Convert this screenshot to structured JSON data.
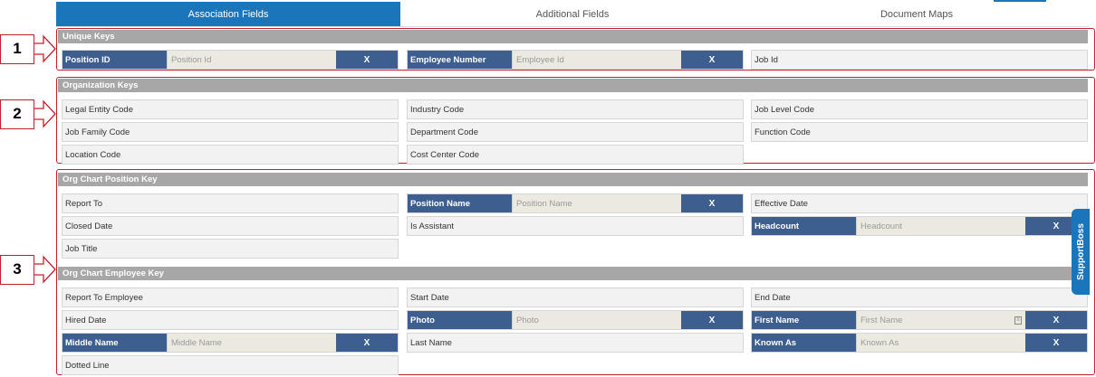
{
  "tabs": [
    {
      "label": "Association Fields"
    },
    {
      "label": "Additional Fields"
    },
    {
      "label": "Document Maps"
    }
  ],
  "callouts": [
    "1",
    "2",
    "3"
  ],
  "sections": {
    "unique_keys": "Unique Keys",
    "organization_keys": "Organization Keys",
    "org_chart_position_key": "Org Chart Position Key",
    "org_chart_employee_key": "Org Chart Employee Key"
  },
  "remove_label": "X",
  "fields": {
    "position_id": {
      "label": "Position ID",
      "placeholder": "Position Id"
    },
    "employee_number": {
      "label": "Employee Number",
      "placeholder": "Employee Id"
    },
    "job_id": "Job Id",
    "legal_entity_code": "Legal Entity Code",
    "industry_code": "Industry Code",
    "job_level_code": "Job Level Code",
    "job_family_code": "Job Family Code",
    "department_code": "Department Code",
    "function_code": "Function Code",
    "location_code": "Location Code",
    "cost_center_code": "Cost Center Code",
    "report_to": "Report To",
    "position_name": {
      "label": "Position Name",
      "placeholder": "Position Name"
    },
    "effective_date": "Effective Date",
    "closed_date": "Closed Date",
    "is_assistant": "Is Assistant",
    "headcount": {
      "label": "Headcount",
      "placeholder": "Headcount"
    },
    "job_title": "Job Title",
    "report_to_employee": "Report To Employee",
    "start_date": "Start Date",
    "end_date": "End Date",
    "hired_date": "Hired Date",
    "photo": {
      "label": "Photo",
      "placeholder": "Photo"
    },
    "first_name": {
      "label": "First Name",
      "placeholder": "First Name"
    },
    "middle_name": {
      "label": "Middle Name",
      "placeholder": "Middle Name"
    },
    "last_name": "Last Name",
    "known_as": {
      "label": "Known As",
      "placeholder": "Known As"
    },
    "dotted_line": "Dotted Line"
  },
  "support_tab": "SupportBoss",
  "colors": {
    "tab_active": "#1b75bb",
    "mapped_label": "#3d5f8f",
    "section_bar": "#a7a7a7",
    "callout_border": "#c0202a"
  }
}
